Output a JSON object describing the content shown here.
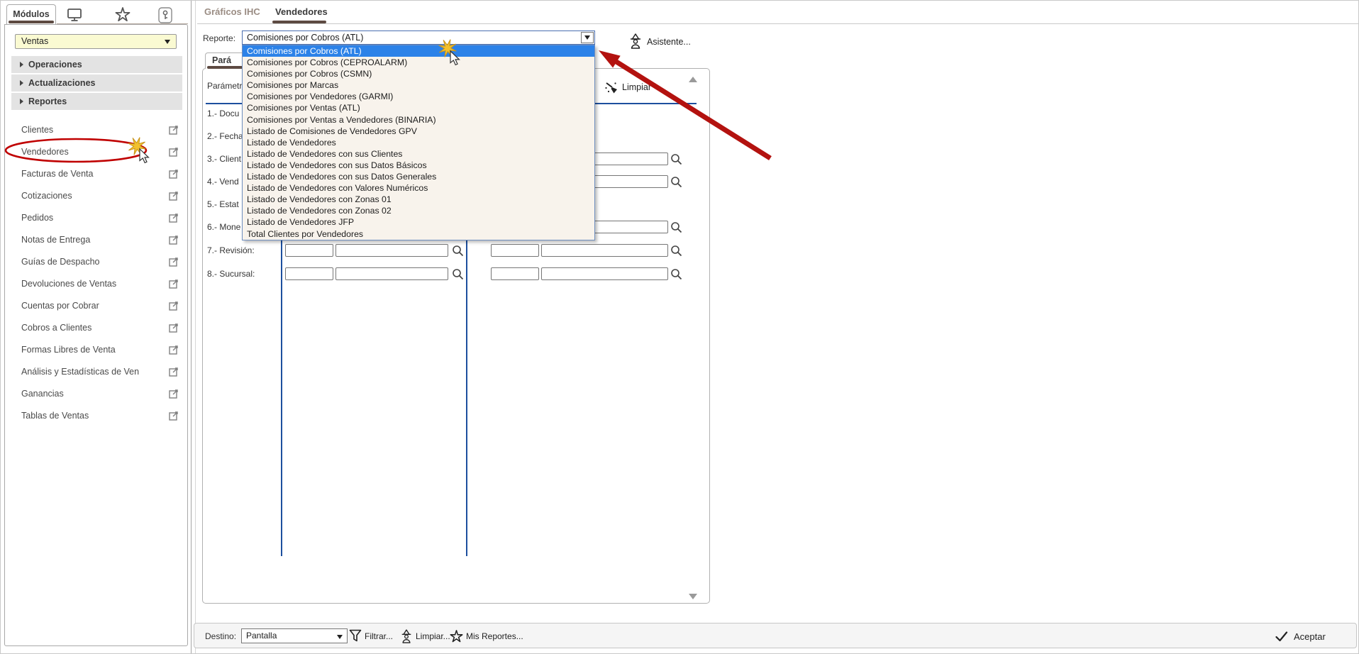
{
  "sidebar": {
    "tab_label": "Módulos",
    "header_icons": [
      "monitor-icon",
      "star-icon",
      "key-icon"
    ],
    "module_select_value": "Ventas",
    "sections": [
      {
        "label": "Operaciones"
      },
      {
        "label": "Actualizaciones"
      },
      {
        "label": "Reportes"
      }
    ],
    "links": [
      "Clientes",
      "Vendedores",
      "Facturas de Venta",
      "Cotizaciones",
      "Pedidos",
      "Notas de Entrega",
      "Guías de Despacho",
      "Devoluciones de Ventas",
      "Cuentas por Cobrar",
      "Cobros a Clientes",
      "Formas Libres de Venta",
      "Análisis y Estadísticas de Ven",
      "Ganancias",
      "Tablas de Ventas"
    ],
    "circled_link": "Vendedores"
  },
  "main": {
    "tabs": [
      {
        "label": "Gráficos IHC",
        "active": false
      },
      {
        "label": "Vendedores",
        "active": true
      }
    ],
    "report": {
      "label": "Reporte:",
      "selected": "Comisiones por Cobros (ATL)",
      "highlighted_index": 0,
      "options": [
        "Comisiones por Cobros (ATL)",
        "Comisiones por Cobros (CEPROALARM)",
        "Comisiones por Cobros (CSMN)",
        "Comisiones por Marcas",
        "Comisiones por Vendedores (GARMI)",
        "Comisiones por Ventas (ATL)",
        "Comisiones por Ventas a Vendedores (BINARIA)",
        "Listado de Comisiones de Vendedores GPV",
        "Listado de Vendedores",
        "Listado de Vendedores con sus Clientes",
        "Listado de Vendedores con sus Datos Básicos",
        "Listado de Vendedores con sus Datos Generales",
        "Listado de Vendedores con Valores Numéricos",
        "Listado de Vendedores con Zonas 01",
        "Listado de Vendedores con Zonas 02",
        "Listado de Vendedores JFP",
        "Total Clientes por Vendedores"
      ]
    },
    "assistant_button": "Asistente...",
    "panel": {
      "tab_label": "Pará",
      "header_label": "Parámetr",
      "clear_button": "Limpiar",
      "params": [
        {
          "label": "1.- Docu",
          "left_pair": false,
          "right_pair": false
        },
        {
          "label": "2.- Fecha",
          "left_pair": false,
          "right_pair": false
        },
        {
          "label": "3.- Client",
          "left_pair": false,
          "right_pair": true
        },
        {
          "label": "4.- Vend",
          "left_pair": false,
          "right_pair": true
        },
        {
          "label": "5.- Estat",
          "left_pair": false,
          "right_pair": false
        },
        {
          "label": "6.- Mone",
          "left_pair": false,
          "right_pair": true
        },
        {
          "label": "7.- Revisión:",
          "left_pair": true,
          "right_pair": true
        },
        {
          "label": "8.- Sucursal:",
          "left_pair": true,
          "right_pair": true
        }
      ]
    }
  },
  "footer": {
    "destination_label": "Destino:",
    "destination_value": "Pantalla",
    "filter_button": "Filtrar...",
    "clear_button": "Limpiar...",
    "my_reports_button": "Mis Reportes...",
    "accept_button": "Aceptar"
  },
  "annotations": {
    "red": "#c00000",
    "arrow_red": "#b3120f",
    "star_yellow": "#f2c12e"
  }
}
